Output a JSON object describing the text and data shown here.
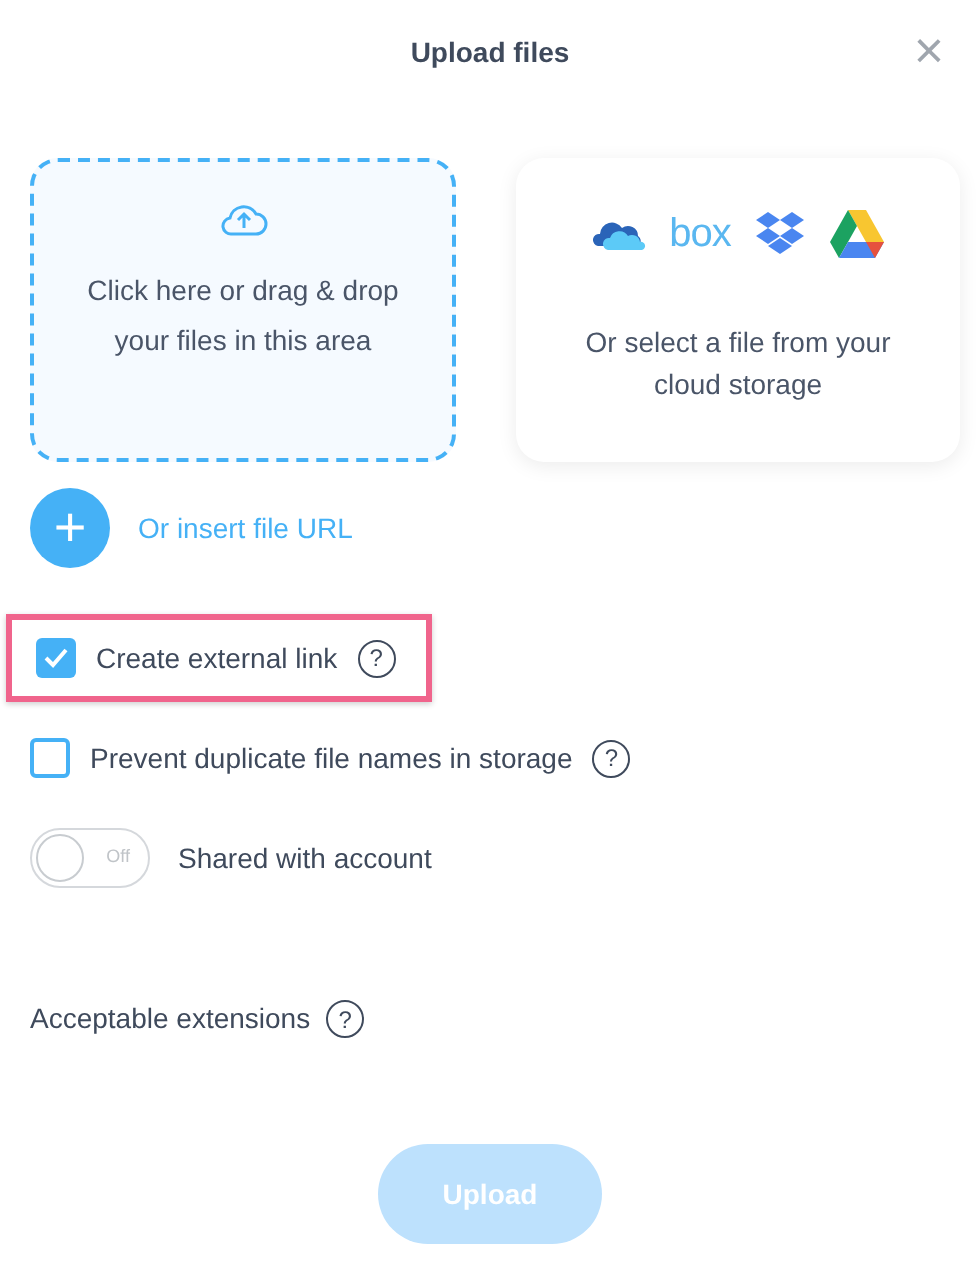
{
  "dialog": {
    "title": "Upload files",
    "close": "×"
  },
  "drop_zone": {
    "text": "Click here or drag & drop your files in this area"
  },
  "cloud_storage": {
    "box_logo": "box",
    "text": "Or select a file from your cloud storage"
  },
  "insert_url": {
    "icon": "+",
    "label": "Or insert file URL"
  },
  "options": [
    {
      "kind": "checkbox",
      "label": "Create external link",
      "checked": true,
      "highlighted": true,
      "help": "?"
    },
    {
      "kind": "checkbox",
      "label": "Prevent duplicate file names in storage",
      "checked": false,
      "highlighted": false,
      "help": "?"
    },
    {
      "kind": "toggle",
      "label": "Shared with account",
      "on": false,
      "state_text": "Off"
    }
  ],
  "extensions": {
    "label": "Acceptable extensions",
    "help": "?"
  },
  "upload_button": {
    "label": "Upload",
    "disabled": true
  }
}
